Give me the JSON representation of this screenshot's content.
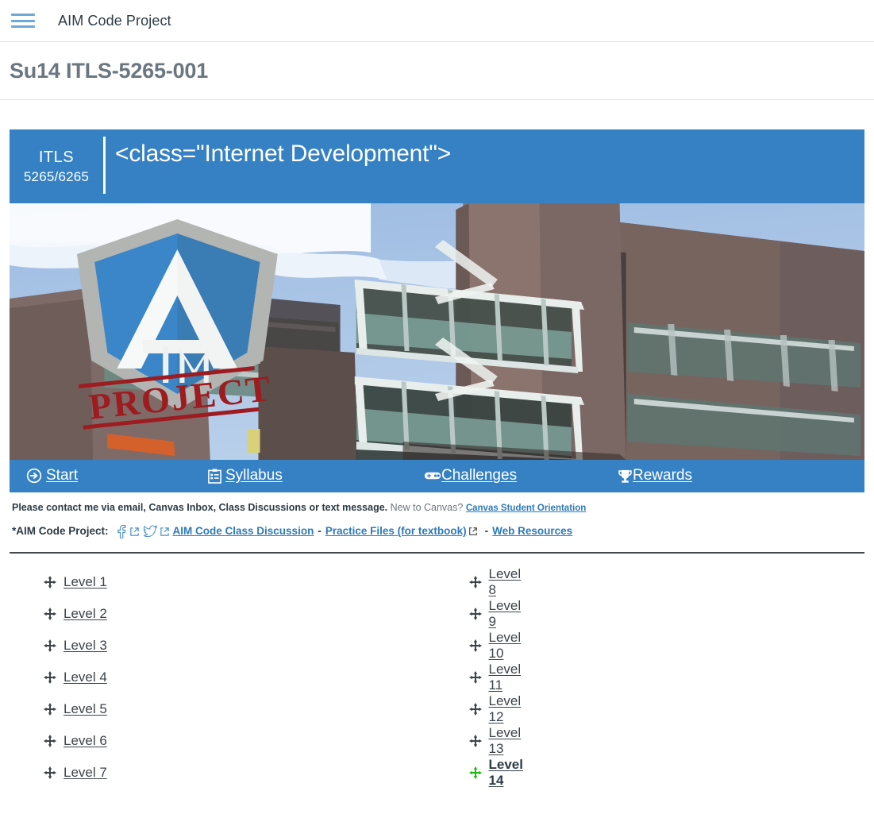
{
  "topbar": {
    "menu_icon": "hamburger-icon",
    "title": "AIM Code Project"
  },
  "page": {
    "title": "Su14 ITLS-5265-001"
  },
  "banner": {
    "code_line1": "ITLS",
    "code_line2": "5265/6265",
    "title": "<class=\"Internet Development\">",
    "bg_color": "#3581c4"
  },
  "hero": {
    "alt": "AIM Project shield logo over illustrated photo of a modern glass and brick university building",
    "logo_letter_main": "A",
    "logo_letter_i": "I",
    "logo_letter_m": "M",
    "logo_stamp": "PROJECT",
    "sky_color": "#a8c4e4",
    "shield_color": "#3581c4",
    "stamp_color": "#9e1b20"
  },
  "nav": {
    "bg_color": "#3581c4",
    "items": [
      {
        "label": "Start",
        "icon": "arrow-circle-right-icon"
      },
      {
        "label": "Syllabus",
        "icon": "clipboard-icon"
      },
      {
        "label": "Challenges",
        "icon": "gamepad-icon"
      },
      {
        "label": "Rewards",
        "icon": "trophy-icon"
      }
    ]
  },
  "notes": {
    "contact_bold": "Please contact me via email, Canvas Inbox, Class Discussions or text message.",
    "contact_light": "New to Canvas?",
    "contact_link": "Canvas Student Orientation",
    "project_label": "*AIM Code Project:",
    "facebook_icon": "facebook-icon",
    "twitter_icon": "twitter-icon",
    "external_icon": "external-link-icon",
    "links": [
      {
        "label": "AIM Code Class Discussion",
        "external": false
      },
      {
        "label": "Practice Files (for textbook)",
        "external": true
      },
      {
        "label": "Web Resources",
        "external": false
      }
    ],
    "separator": "-"
  },
  "levels": {
    "icon": "move-diamond-icon",
    "current_icon_color": "#1fb714",
    "left": [
      {
        "label": "Level 1",
        "current": false
      },
      {
        "label": "Level 2",
        "current": false
      },
      {
        "label": "Level 3",
        "current": false
      },
      {
        "label": "Level 4",
        "current": false
      },
      {
        "label": "Level 5",
        "current": false
      },
      {
        "label": "Level 6",
        "current": false
      },
      {
        "label": "Level 7",
        "current": false
      }
    ],
    "right": [
      {
        "label": "Level 8",
        "current": false
      },
      {
        "label": "Level 9",
        "current": false
      },
      {
        "label": "Level 10",
        "current": false
      },
      {
        "label": "Level 11",
        "current": false
      },
      {
        "label": "Level 12",
        "current": false
      },
      {
        "label": "Level 13",
        "current": false
      },
      {
        "label": "Level 14",
        "current": true
      }
    ]
  }
}
